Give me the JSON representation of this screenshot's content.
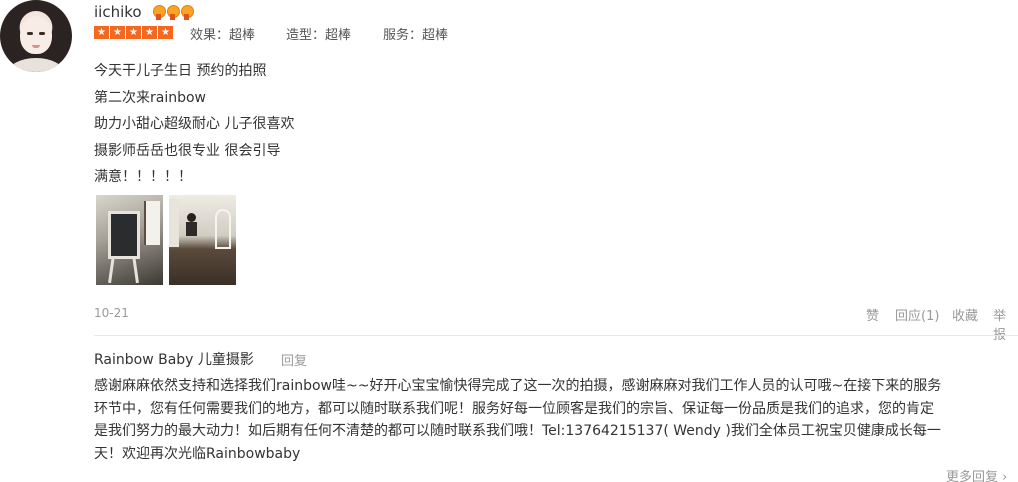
{
  "review": {
    "username": "iichiko",
    "medal_icons": [
      "medal-icon",
      "medal-icon",
      "medal-icon"
    ],
    "rating": 5,
    "scores": [
      {
        "label": "效果：超棒"
      },
      {
        "label": "造型：超棒"
      },
      {
        "label": "服务：超棒"
      }
    ],
    "lines": [
      "今天干儿子生日 预约的拍照",
      "第二次来rainbow",
      "助力小甜心超级耐心 儿子很喜欢",
      "摄影师岳岳也很专业 很会引导",
      "满意！！！！！"
    ],
    "date": "10-21",
    "actions": {
      "like": "赞",
      "reply": "回应(1)",
      "favorite": "收藏",
      "report": "举报"
    }
  },
  "reply": {
    "author": "Rainbow Baby 儿童摄影",
    "reply_link": "回复",
    "lines": [
      "感谢麻麻依然支持和选择我们rainbow哇~~好开心宝宝愉快得完成了这一次的拍摄，感谢麻麻对我们工作人员的认可哦~在接下来的服务",
      "环节中，您有任何需要我们的地方，都可以随时联系我们呢！服务好每一位顾客是我们的宗旨、保证每一份品质是我们的追求，您的肯定",
      "是我们努力的最大动力！如后期有任何不清楚的都可以随时联系我们哦！Tel:13764215137( Wendy )我们全体员工祝宝贝健康成长每一",
      "天！欢迎再次光临Rainbowbaby"
    ]
  },
  "more_replies": "更多回复 ›",
  "colors": {
    "accent": "#f5671f",
    "muted": "#999999",
    "text": "#333333"
  }
}
